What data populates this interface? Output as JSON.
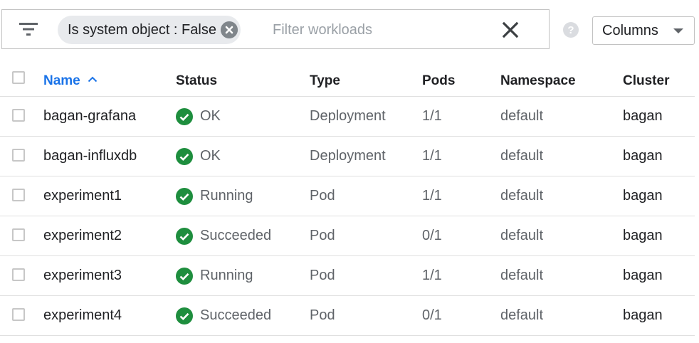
{
  "filter": {
    "chip_label": "Is system object : False",
    "placeholder": "Filter workloads",
    "value": ""
  },
  "columns_button": {
    "label": "Columns"
  },
  "table": {
    "headers": {
      "name": "Name",
      "status": "Status",
      "type": "Type",
      "pods": "Pods",
      "namespace": "Namespace",
      "cluster": "Cluster"
    },
    "sort": {
      "column": "name",
      "direction": "ascending"
    },
    "rows": [
      {
        "name": "bagan-grafana",
        "status": "OK",
        "type": "Deployment",
        "pods": "1/1",
        "namespace": "default",
        "cluster": "bagan"
      },
      {
        "name": "bagan-influxdb",
        "status": "OK",
        "type": "Deployment",
        "pods": "1/1",
        "namespace": "default",
        "cluster": "bagan"
      },
      {
        "name": "experiment1",
        "status": "Running",
        "type": "Pod",
        "pods": "1/1",
        "namespace": "default",
        "cluster": "bagan"
      },
      {
        "name": "experiment2",
        "status": "Succeeded",
        "type": "Pod",
        "pods": "0/1",
        "namespace": "default",
        "cluster": "bagan"
      },
      {
        "name": "experiment3",
        "status": "Running",
        "type": "Pod",
        "pods": "1/1",
        "namespace": "default",
        "cluster": "bagan"
      },
      {
        "name": "experiment4",
        "status": "Succeeded",
        "type": "Pod",
        "pods": "0/1",
        "namespace": "default",
        "cluster": "bagan"
      }
    ]
  },
  "icons": {
    "filter": "filter-list-icon",
    "chip_remove": "cancel-icon",
    "clear": "close-icon",
    "help": "help-icon",
    "dropdown": "arrow-drop-down-icon",
    "sort": "sort-ascending-icon",
    "status": "check-circle-icon",
    "select": "checkbox-icon"
  },
  "colors": {
    "accent": "#1a73e8",
    "status_ok": "#1e8e3e",
    "border": "#c2c2c2",
    "chip_bg": "#e8eaed"
  }
}
